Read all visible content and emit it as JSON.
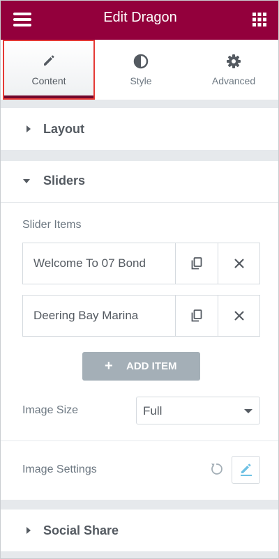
{
  "header": {
    "title": "Edit Dragon",
    "menu_icon": "hamburger-icon",
    "apps_icon": "grid-icon",
    "background": "#93003c"
  },
  "tabs": [
    {
      "label": "Content",
      "icon": "pencil-icon",
      "active": true
    },
    {
      "label": "Style",
      "icon": "half-circle-icon"
    },
    {
      "label": "Advanced",
      "icon": "gear-icon"
    }
  ],
  "sections": {
    "layout": {
      "title": "Layout",
      "expanded": false
    },
    "sliders": {
      "title": "Sliders",
      "expanded": true
    },
    "social_share": {
      "title": "Social Share",
      "expanded": false
    }
  },
  "slider_items": {
    "label": "Slider Items",
    "items": [
      {
        "title": "Welcome To 07 Bond"
      },
      {
        "title": "Deering Bay Marina"
      }
    ],
    "add_label": "ADD ITEM"
  },
  "image_size": {
    "label": "Image Size",
    "value": "Full"
  },
  "image_settings": {
    "label": "Image Settings"
  },
  "colors": {
    "accent": "#93003c",
    "tab_underline": "#71072c",
    "highlight_border": "#e53935",
    "edit_icon": "#6ec1e4",
    "button": "#a4afb7"
  }
}
